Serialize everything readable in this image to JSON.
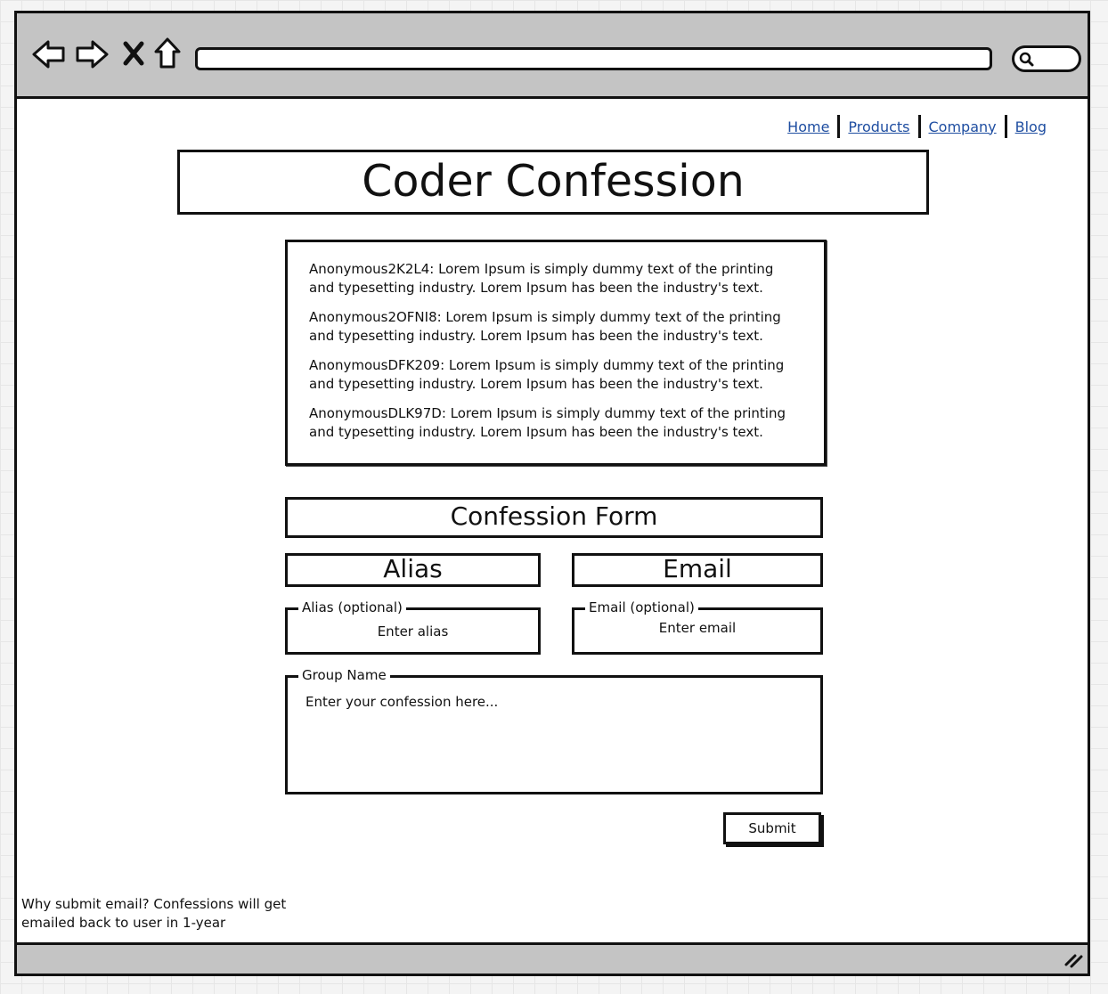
{
  "browser": {
    "icons": [
      "back-arrow-icon",
      "forward-arrow-icon",
      "close-icon",
      "home-icon",
      "search-icon",
      "resize-grip-icon"
    ]
  },
  "nav_links": [
    "Home",
    "Products",
    "Company",
    "Blog"
  ],
  "page_title": "Coder Confession",
  "confessions": [
    {
      "text": "Anonymous2K2L4: Lorem Ipsum is simply dummy text of the printing and typesetting industry. Lorem Ipsum has been the industry's text."
    },
    {
      "text": "Anonymous2OFNI8: Lorem Ipsum is simply dummy text of the printing and typesetting industry. Lorem Ipsum has been the industry's text."
    },
    {
      "text": "AnonymousDFK209: Lorem Ipsum is simply dummy text of the printing and typesetting industry. Lorem Ipsum has been the industry's text."
    },
    {
      "text": "AnonymousDLK97D: Lorem Ipsum is simply dummy text of the printing and typesetting industry. Lorem Ipsum has been the industry's text."
    }
  ],
  "form": {
    "title": "Confession Form",
    "alias_heading": "Alias",
    "email_heading": "Email",
    "alias_legend": "Alias (optional)",
    "alias_placeholder": "Enter alias",
    "email_legend": "Email (optional)",
    "email_placeholder": "Enter email",
    "confession_legend": "Group Name",
    "confession_placeholder": "Enter your confession here...",
    "submit_label": "Submit"
  },
  "footer_note": "Why submit email? Confessions will get emailed back to user in 1-year",
  "colors": {
    "toolbar": "#c4c4c4",
    "link": "#1f4ea1"
  }
}
